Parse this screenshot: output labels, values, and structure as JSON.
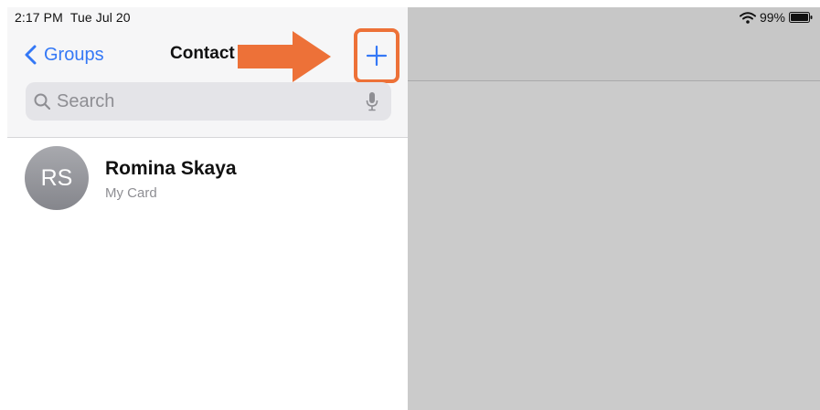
{
  "status_bar": {
    "time": "2:17 PM",
    "date": "Tue Jul 20",
    "battery": "99%"
  },
  "nav": {
    "back_label": "Groups",
    "title": "Contact",
    "add_label": "+"
  },
  "search": {
    "placeholder": "Search"
  },
  "contacts": [
    {
      "initials": "RS",
      "name": "Romina Skaya",
      "subtitle": "My Card"
    }
  ],
  "colors": {
    "accent": "#3478f6",
    "highlight": "#ed7138",
    "avatar": "#95969b",
    "detail_pane": "#cbcbcb"
  },
  "icons": [
    "chevron-left-icon",
    "plus-icon",
    "search-icon",
    "microphone-icon",
    "wifi-icon",
    "battery-icon",
    "arrow-right-icon"
  ]
}
